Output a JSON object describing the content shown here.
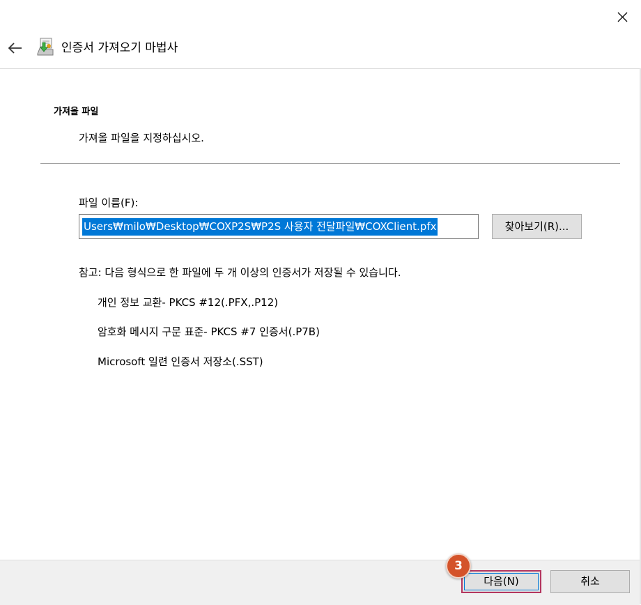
{
  "window": {
    "title": "인증서 가져오기 마법사",
    "back_icon": "back-arrow-icon",
    "close_icon": "close-icon",
    "wizard_icon": "certificate-import-icon"
  },
  "section": {
    "heading": "가져올 파일",
    "description": "가져올 파일을 지정하십시오."
  },
  "file": {
    "label": "파일 이름(F):",
    "value": "Users₩milo₩Desktop₩COXP2S₩P2S 사용자 전달파일₩COXClient.pfx",
    "browse_label": "찾아보기(R)..."
  },
  "note": "참고: 다음 형식으로 한 파일에 두 개 이상의 인증서가 저장될 수 있습니다.",
  "formats": [
    "개인 정보 교환- PKCS #12(.PFX,.P12)",
    "암호화 메시지 구문 표준- PKCS #7 인증서(.P7B)",
    "Microsoft 일련 인증서 저장소(.SST)"
  ],
  "footer": {
    "next_label": "다음(N)",
    "cancel_label": "취소"
  },
  "step_badge": "3",
  "colors": {
    "selection": "#0078d7",
    "highlight_border": "#b4365f",
    "badge": "#d4532a",
    "footer_bg": "#f0f0f0"
  }
}
